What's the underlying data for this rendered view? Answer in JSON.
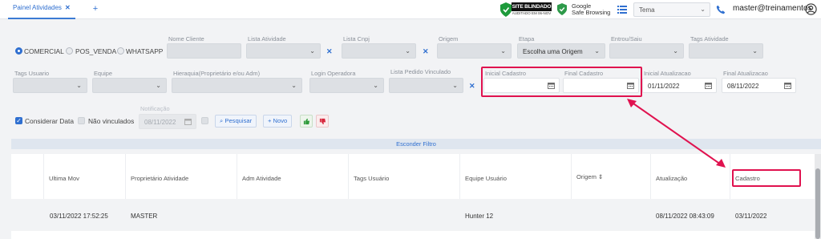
{
  "tabs": {
    "active_label": "Painel Atividades",
    "close": "✕",
    "add": "+"
  },
  "header": {
    "site_blindado": "SITE BLINDADO",
    "site_blindado_sub": "AUDITADO EM 06-NOV",
    "google_line1": "Google",
    "google_line2": "Safe Browsing",
    "tema_placeholder": "Tema",
    "user": "master@treinamentos"
  },
  "filters": {
    "radios": [
      "COMERCIAL",
      "POS_VENDA",
      "WHATSAPP"
    ],
    "selected_radio": "COMERCIAL",
    "nome_cliente": "Nome Cliente",
    "lista_atividade": "Lista Atividade",
    "lista_cnpj": "Lista Cnpj",
    "origem": "Origem",
    "etapa": "Etapa",
    "etapa_value": "Escolha uma Origem",
    "entrou_saiu": "Entrou/Saiu",
    "tags_atividade": "Tags Atividade",
    "tags_usuario": "Tags Usuario",
    "equipe": "Equipe",
    "hierarquia": "Hieraquia(Proprietário e/ou Adm)",
    "login_operadora": "Login Operadora",
    "lista_pedido": "Lista Pedido Vinculado",
    "inicial_cadastro": "Inicial Cadastro",
    "final_cadastro": "Final Cadastro",
    "inicial_atualizacao": "Inicial Atualizacao",
    "inicial_atualizacao_value": "01/11/2022",
    "final_atualizacao": "Final Atualizacao",
    "final_atualizacao_value": "08/11/2022",
    "considerar_data": "Considerar Data",
    "nao_vinculados": "Não vinculados",
    "notificacao": "Notificação",
    "notificacao_value": "08/11/2022",
    "pesquisar": "Pesquisar",
    "novo": "Novo",
    "clear_x": "✕"
  },
  "hide_filter": "Esconder Filtro",
  "table": {
    "columns": [
      "Ultima Mov",
      "Proprietário Atividade",
      "Adm Atividade",
      "Tags Usuário",
      "Equipe Usuário",
      "Origem",
      "Atualização",
      "Cadastro"
    ],
    "sort_icon": "⇕",
    "rows": [
      {
        "ultima_mov": "03/11/2022 17:52:25",
        "proprietario": "MASTER",
        "adm": "",
        "tags": "",
        "equipe": "Hunter 12",
        "origem": "",
        "atualizacao": "08/11/2022 08:43:09",
        "cadastro": "03/11/2022"
      }
    ]
  },
  "colors": {
    "accent": "#2f6fd0",
    "highlight": "#e0124f"
  }
}
